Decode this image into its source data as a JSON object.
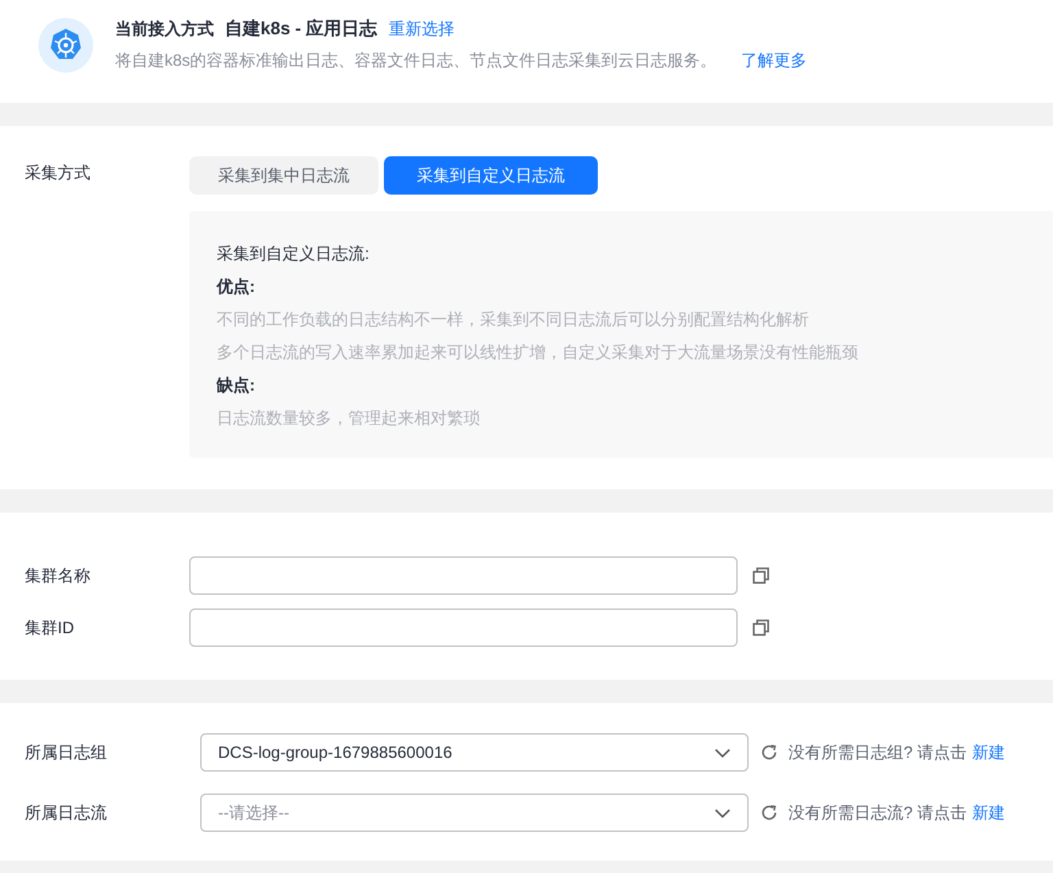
{
  "header": {
    "label": "当前接入方式",
    "title": "自建k8s - 应用日志",
    "reselect_link": "重新选择",
    "description": "将自建k8s的容器标准输出日志、容器文件日志、节点文件日志采集到云日志服务。",
    "learn_more_link": "了解更多"
  },
  "collection": {
    "label": "采集方式",
    "tabs": [
      {
        "label": "采集到集中日志流",
        "selected": false
      },
      {
        "label": "采集到自定义日志流",
        "selected": true
      }
    ],
    "info": [
      {
        "kind": "title",
        "text": "采集到自定义日志流:"
      },
      {
        "kind": "heading",
        "text": "优点:"
      },
      {
        "kind": "item",
        "text": "不同的工作负载的日志结构不一样，采集到不同日志流后可以分别配置结构化解析"
      },
      {
        "kind": "item",
        "text": "多个日志流的写入速率累加起来可以线性扩增，自定义采集对于大流量场景没有性能瓶颈"
      },
      {
        "kind": "heading",
        "text": "缺点:"
      },
      {
        "kind": "item",
        "text": "日志流数量较多，管理起来相对繁琐"
      }
    ]
  },
  "cluster_fields": [
    {
      "label": "集群名称"
    },
    {
      "label": "集群ID"
    }
  ],
  "log_selects": [
    {
      "label": "所属日志组",
      "value": "DCS-log-group-1679885600016",
      "hint": "没有所需日志组? 请点击",
      "create_link": "新建"
    },
    {
      "label": "所属日志流",
      "placeholder": "--请选择--",
      "hint": "没有所需日志流? 请点击",
      "create_link": "新建"
    }
  ]
}
